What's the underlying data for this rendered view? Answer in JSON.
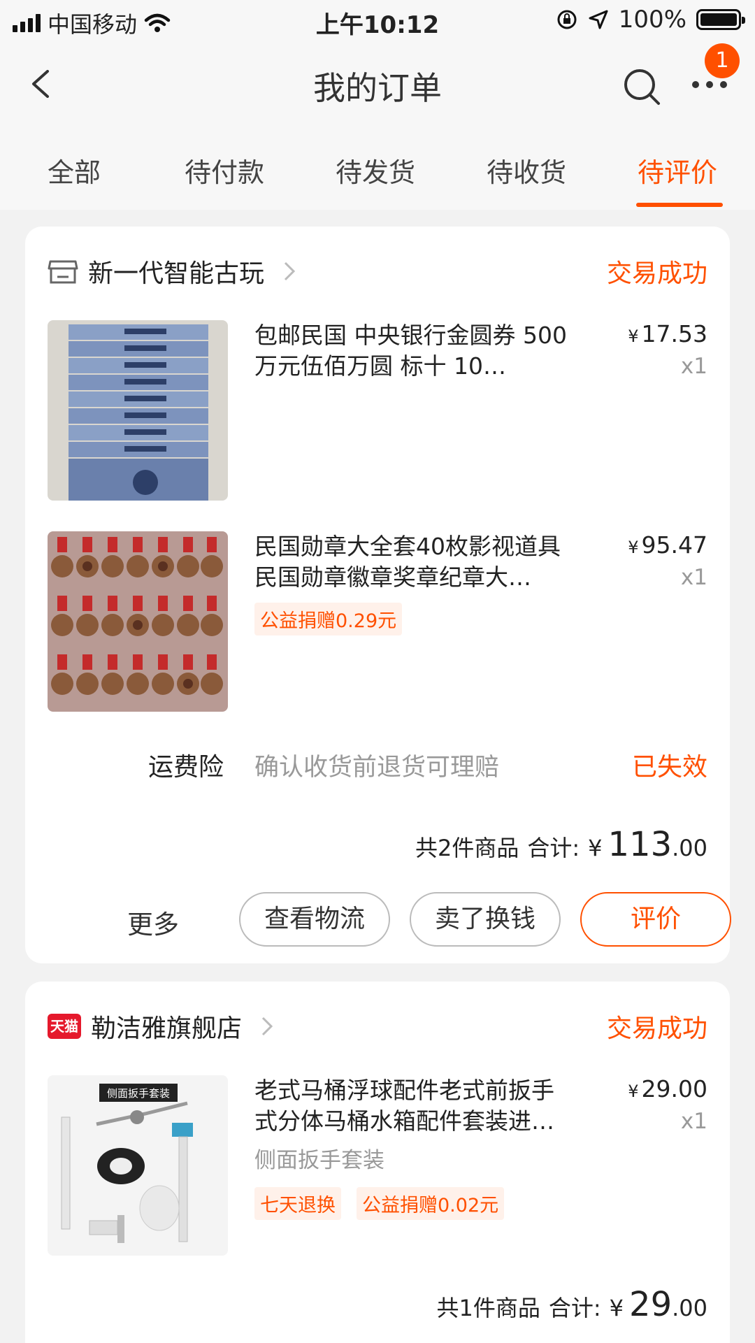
{
  "status_bar": {
    "carrier": "中国移动",
    "time": "上午10:12",
    "battery": "100%"
  },
  "nav": {
    "title": "我的订单",
    "badge": "1"
  },
  "tabs": [
    {
      "label": "全部"
    },
    {
      "label": "待付款"
    },
    {
      "label": "待发货"
    },
    {
      "label": "待收货"
    },
    {
      "label": "待评价"
    }
  ],
  "orders": [
    {
      "shop": "新一代智能古玩",
      "status": "交易成功",
      "items": [
        {
          "title": "包邮民国 中央银行金圆券 500万元伍佰万圆 标十 10…",
          "price_yen": "¥",
          "price": "17.53",
          "qty": "x1"
        },
        {
          "title": "民国勋章大全套40枚影视道具民国勋章徽章奖章纪章大…",
          "price_yen": "¥",
          "price": "95.47",
          "qty": "x1",
          "tags": [
            "公益捐赠0.29元"
          ]
        }
      ],
      "insurance": {
        "label": "运费险",
        "desc": "确认收货前退货可理赔",
        "status": "已失效"
      },
      "total": {
        "count_text": "共2件商品",
        "sum_label": "合计:",
        "yen": "¥",
        "integer": "113",
        "decimal": ".00"
      },
      "actions": {
        "more": "更多",
        "logistics": "查看物流",
        "resell": "卖了换钱",
        "review": "评价"
      }
    },
    {
      "shop": "勒洁雅旗舰店",
      "shop_badge": "天猫",
      "status": "交易成功",
      "items": [
        {
          "title": "老式马桶浮球配件老式前扳手式分体马桶水箱配件套装进…",
          "price_yen": "¥",
          "price": "29.00",
          "qty": "x1",
          "sku": "侧面扳手套装",
          "image_label": "侧面扳手套装",
          "tags": [
            "七天退换",
            "公益捐赠0.02元"
          ]
        }
      ],
      "total": {
        "count_text": "共1件商品",
        "sum_label": "合计:",
        "yen": "¥",
        "integer": "29",
        "decimal": ".00"
      }
    }
  ],
  "colors": {
    "accent": "#ff5000",
    "background": "#f2f2f2",
    "muted_text": "#999999"
  }
}
